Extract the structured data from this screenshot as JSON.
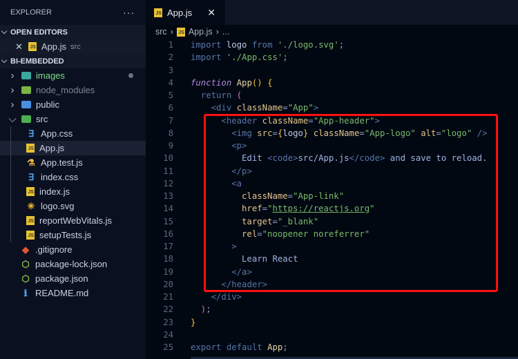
{
  "sidebar": {
    "title": "EXPLORER",
    "more": "···",
    "open_editors": {
      "label": "OPEN EDITORS",
      "items": [
        {
          "name": "App.js",
          "dir": "src"
        }
      ]
    },
    "project": {
      "label": "BI-EMBEDDED",
      "items": [
        {
          "name": "images",
          "type": "folder",
          "depth": 0,
          "expanded": false,
          "color": "#7ddf8a",
          "icon_color": "#3aa8a0",
          "modified": true
        },
        {
          "name": "node_modules",
          "type": "folder",
          "depth": 0,
          "expanded": false,
          "color": "#7c8496",
          "icon_color": "#7cb342"
        },
        {
          "name": "public",
          "type": "folder",
          "depth": 0,
          "expanded": false,
          "color": "#c9d1e4",
          "icon_color": "#4a90e2"
        },
        {
          "name": "src",
          "type": "folder",
          "depth": 0,
          "expanded": true,
          "color": "#c9d1e4",
          "icon_color": "#4caf50"
        },
        {
          "name": "App.css",
          "type": "css",
          "depth": 1
        },
        {
          "name": "App.js",
          "type": "js",
          "depth": 1,
          "selected": true
        },
        {
          "name": "App.test.js",
          "type": "test",
          "depth": 1
        },
        {
          "name": "index.css",
          "type": "css",
          "depth": 1
        },
        {
          "name": "index.js",
          "type": "js",
          "depth": 1
        },
        {
          "name": "logo.svg",
          "type": "svg",
          "depth": 1
        },
        {
          "name": "reportWebVitals.js",
          "type": "js",
          "depth": 1
        },
        {
          "name": "setupTests.js",
          "type": "js",
          "depth": 1
        },
        {
          "name": ".gitignore",
          "type": "git",
          "depth": 0
        },
        {
          "name": "package-lock.json",
          "type": "node",
          "depth": 0
        },
        {
          "name": "package.json",
          "type": "node",
          "depth": 0
        },
        {
          "name": "README.md",
          "type": "info",
          "depth": 0
        }
      ]
    }
  },
  "tab": {
    "label": "App.js",
    "close": "✕"
  },
  "breadcrumb": [
    "src",
    "App.js",
    "..."
  ],
  "highlight_color": "#ff1010",
  "code": [
    [
      [
        "import ",
        "kw"
      ],
      [
        "logo ",
        "id"
      ],
      [
        "from ",
        "kw"
      ],
      [
        "'./logo.svg'",
        "str"
      ],
      [
        ";",
        "pu"
      ]
    ],
    [
      [
        "import ",
        "kw"
      ],
      [
        "'./App.css'",
        "str"
      ],
      [
        ";",
        "pu"
      ]
    ],
    [],
    [
      [
        "function ",
        "fn"
      ],
      [
        "App",
        "nm"
      ],
      [
        "() ",
        "br"
      ],
      [
        "{",
        "br"
      ]
    ],
    [
      [
        "  return ",
        "kw"
      ],
      [
        "(",
        "pr"
      ]
    ],
    [
      [
        "    <",
        "tag"
      ],
      [
        "div ",
        "tag"
      ],
      [
        "className",
        "at"
      ],
      [
        "=",
        "pu"
      ],
      [
        "\"App\"",
        "str"
      ],
      [
        ">",
        "tag"
      ]
    ],
    [
      [
        "      <",
        "tag"
      ],
      [
        "header ",
        "tag"
      ],
      [
        "className",
        "at"
      ],
      [
        "=",
        "pu"
      ],
      [
        "\"App-header\"",
        "str"
      ],
      [
        ">",
        "tag"
      ]
    ],
    [
      [
        "        <",
        "tag"
      ],
      [
        "img ",
        "tag"
      ],
      [
        "src",
        "at"
      ],
      [
        "=",
        "pu"
      ],
      [
        "{",
        "br"
      ],
      [
        "logo",
        "id"
      ],
      [
        "} ",
        "br"
      ],
      [
        "className",
        "at"
      ],
      [
        "=",
        "pu"
      ],
      [
        "\"App-logo\" ",
        "str"
      ],
      [
        "alt",
        "at"
      ],
      [
        "=",
        "pu"
      ],
      [
        "\"logo\" ",
        "str"
      ],
      [
        "/>",
        "tag"
      ]
    ],
    [
      [
        "        <",
        "tag"
      ],
      [
        "p",
        "tag"
      ],
      [
        ">",
        "tag"
      ]
    ],
    [
      [
        "          Edit ",
        "tx"
      ],
      [
        "<",
        "tag"
      ],
      [
        "code",
        "tag"
      ],
      [
        ">",
        "tag"
      ],
      [
        "src/App.js",
        "tx"
      ],
      [
        "</",
        "tag"
      ],
      [
        "code",
        "tag"
      ],
      [
        "> ",
        "tag"
      ],
      [
        "and save to reload.",
        "tx"
      ]
    ],
    [
      [
        "        </",
        "tag"
      ],
      [
        "p",
        "tag"
      ],
      [
        ">",
        "tag"
      ]
    ],
    [
      [
        "        <",
        "tag"
      ],
      [
        "a",
        "tag"
      ]
    ],
    [
      [
        "          className",
        "at"
      ],
      [
        "=",
        "pu"
      ],
      [
        "\"App-link\"",
        "str"
      ]
    ],
    [
      [
        "          href",
        "at"
      ],
      [
        "=",
        "pu"
      ],
      [
        "\"",
        "str"
      ],
      [
        "https://reactjs.org",
        "url"
      ],
      [
        "\"",
        "str"
      ]
    ],
    [
      [
        "          target",
        "at"
      ],
      [
        "=",
        "pu"
      ],
      [
        "\"_blank\"",
        "str"
      ]
    ],
    [
      [
        "          rel",
        "at"
      ],
      [
        "=",
        "pu"
      ],
      [
        "\"noopener noreferrer\"",
        "str"
      ]
    ],
    [
      [
        "        >",
        "tag"
      ]
    ],
    [
      [
        "          Learn React",
        "tx"
      ]
    ],
    [
      [
        "        </",
        "tag"
      ],
      [
        "a",
        "tag"
      ],
      [
        ">",
        "tag"
      ]
    ],
    [
      [
        "      </",
        "tag"
      ],
      [
        "header",
        "tag"
      ],
      [
        ">",
        "tag"
      ]
    ],
    [
      [
        "    </",
        "tag"
      ],
      [
        "div",
        "tag"
      ],
      [
        ">",
        "tag"
      ]
    ],
    [
      [
        "  )",
        "pr"
      ],
      [
        ";",
        "pu"
      ]
    ],
    [
      [
        "}",
        "br"
      ]
    ],
    [],
    [
      [
        "export default ",
        "kw"
      ],
      [
        "App",
        "nm"
      ],
      [
        ";",
        "pu"
      ]
    ]
  ]
}
